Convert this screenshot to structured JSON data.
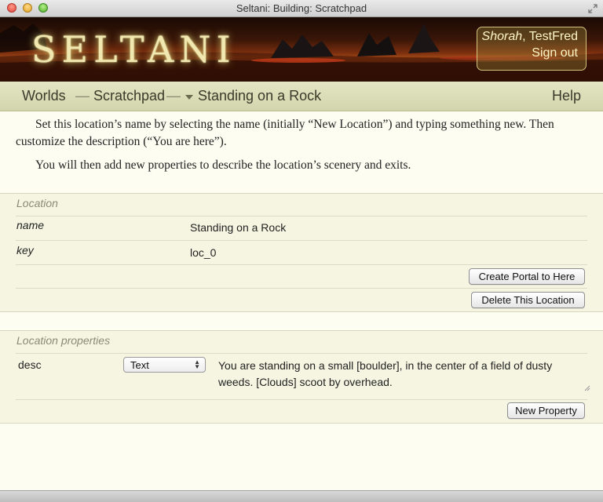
{
  "window": {
    "title": "Seltani: Building: Scratchpad"
  },
  "banner": {
    "logo": "SELTANI",
    "user": {
      "world": "Shorah",
      "separator": ",",
      "name": "TestFred",
      "signout": "Sign out"
    }
  },
  "nav": {
    "worlds": "Worlds",
    "sep1": "—",
    "scratchpad": "Scratchpad",
    "sep2": "—",
    "location": "Standing on a Rock",
    "help": "Help"
  },
  "intro": {
    "p1": "Set this location’s name by selecting the name (initially “New Location”) and typing something new. Then customize the description (“You are here”).",
    "p2": "You will then add new properties to describe the location’s scenery and exits."
  },
  "location": {
    "title": "Location",
    "name_label": "name",
    "name_value": "Standing on a Rock",
    "key_label": "key",
    "key_value": "loc_0",
    "create_portal": "Create Portal to Here",
    "delete_location": "Delete This Location"
  },
  "properties": {
    "title": "Location properties",
    "rows": [
      {
        "key": "desc",
        "type": "Text",
        "value": "You are standing on a small [boulder], in the center of a field of dusty weeds. [Clouds] scoot by overhead."
      }
    ],
    "new_property": "New Property"
  }
}
